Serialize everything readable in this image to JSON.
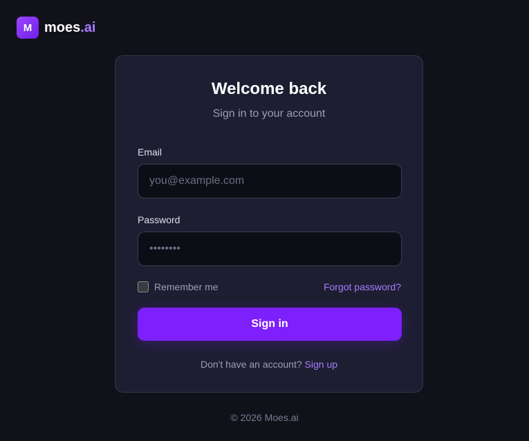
{
  "brand": {
    "mark_letter": "M",
    "name": "moes",
    "suffix": ".ai"
  },
  "card": {
    "title": "Welcome back",
    "subtitle": "Sign in to your account"
  },
  "email": {
    "label": "Email",
    "placeholder": "you@example.com",
    "value": ""
  },
  "password": {
    "label": "Password",
    "placeholder": "••••••••",
    "value": ""
  },
  "remember_me": {
    "label": "Remember me",
    "checked": false
  },
  "forgot_password_label": "Forgot password?",
  "sign_in_label": "Sign in",
  "signup": {
    "prompt": "Don't have an account?",
    "link_label": "Sign up"
  },
  "footer": {
    "copyright": "© 2026 Moes.ai"
  },
  "colors": {
    "background": "#11111a",
    "card": "#1e1e32",
    "accent": "#7d20fb",
    "link": "#a77cff"
  }
}
